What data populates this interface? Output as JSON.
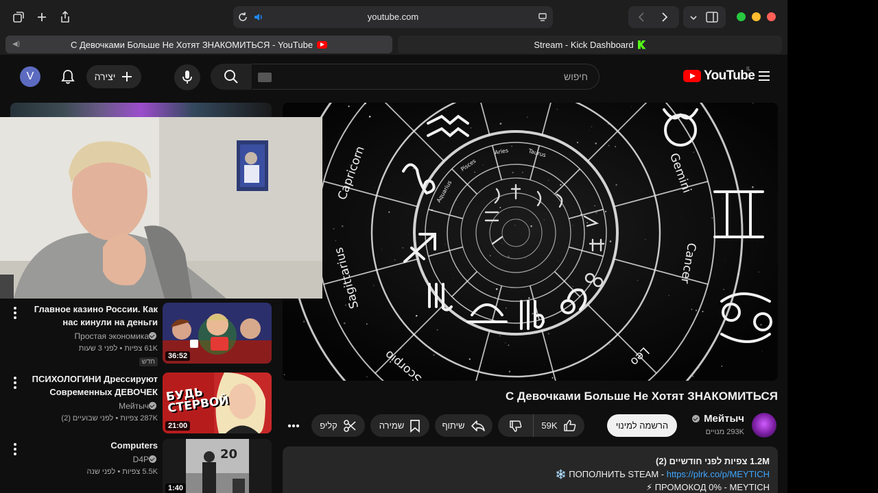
{
  "browser": {
    "url": "youtube.com",
    "tabs": [
      {
        "label": "С Девочками Больше Не Хотят ЗНАКОМИТЬСЯ - YouTube",
        "active": true
      },
      {
        "label": "Stream - Kick Dashboard",
        "active": false
      }
    ]
  },
  "header": {
    "avatar_letter": "V",
    "create_label": "יצירה",
    "search_placeholder": "חיפוש",
    "logo_text": "YouTube",
    "country_code": "IL"
  },
  "player": {
    "zodiac_labels": [
      "Capricorn",
      "Sagittarius",
      "Scorpio",
      "Libra",
      "Virgo",
      "Leo",
      "Cancer",
      "Gemini",
      "Taurus",
      "Aries",
      "Pisces",
      "Aquarius"
    ]
  },
  "recommendations": [
    {
      "title": "Главное казино России. Как нас кинули на деньги",
      "channel": "Простая экономика",
      "meta": "61K צפיות • לפני 3 שעות",
      "badge": "חדש",
      "duration": "36:52"
    },
    {
      "title": "ПСИХОЛОГИНИ Дрессируют Современных ДЕВОЧЕК",
      "channel": "Мейтыч",
      "meta": "287K צפיות • לפני שבועיים (2)",
      "thumb_text": [
        "БУДЬ",
        "СТЕРВОЙ"
      ],
      "duration": "21:00"
    },
    {
      "title": "Computers",
      "channel": "D4P",
      "meta": "5.5K צפיות • לפני שנה",
      "thumb_text": [
        "20"
      ],
      "duration": "1:40"
    }
  ],
  "video": {
    "title": "С Девочками Больше Не Хотят ЗНАКОМИТЬСЯ",
    "channel_name": "Мейтыч",
    "subscribers": "293K מנויים",
    "subscribe_label": "הרשמה למינוי",
    "likes": "59K",
    "share_label": "שיתוף",
    "save_label": "שמירה",
    "clip_label": "קליפ"
  },
  "description": {
    "stats": "1.2M צפיות  לפני חודשיים (2)",
    "line1_text": "❄️ ПОПОЛНИТЬ STEAM - ",
    "line1_link": "https://plrk.co/p/MEYTICH",
    "line2_text": "⚡ ПРОМОКОД 0%  - MEYTICH"
  },
  "colors": {
    "background": "#0f0f0f",
    "surface": "#272727",
    "youtube_red": "#ff0000",
    "link_blue": "#3ea6ff",
    "kick_green": "#53fc18"
  }
}
